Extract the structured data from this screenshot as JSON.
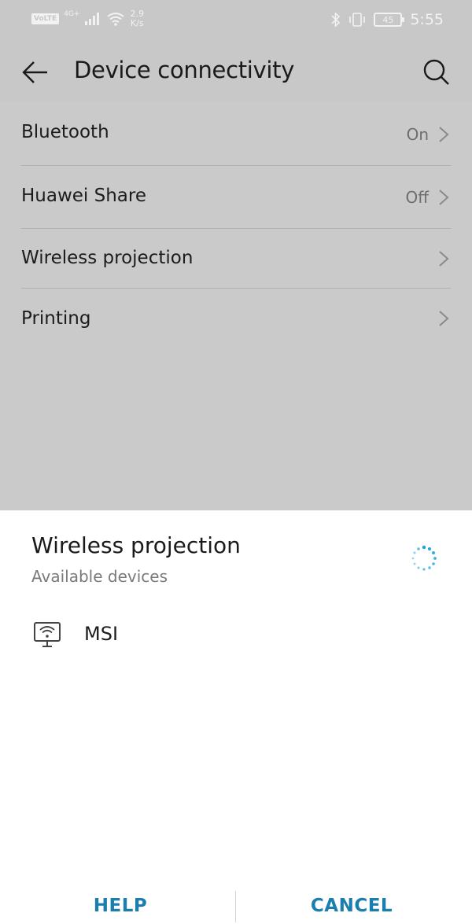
{
  "status_bar": {
    "volte": "VoLTE",
    "network_type": "4G+",
    "speed_value": "2.9",
    "speed_unit": "K/s",
    "battery_level": "45",
    "time": "5:55",
    "icons": [
      "volte-icon",
      "cellular-signal-icon",
      "wifi-icon",
      "bluetooth-icon",
      "vibrate-icon",
      "battery-icon"
    ]
  },
  "app_bar": {
    "title": "Device connectivity",
    "back_icon": "arrow-left-icon",
    "search_icon": "search-icon"
  },
  "settings": {
    "items": [
      {
        "label": "Bluetooth",
        "value": "On"
      },
      {
        "label": "Huawei Share",
        "value": "Off"
      },
      {
        "label": "Wireless projection",
        "value": ""
      },
      {
        "label": "Printing",
        "value": ""
      }
    ]
  },
  "dialog": {
    "title": "Wireless projection",
    "subtitle": "Available devices",
    "devices": [
      {
        "name": "MSI",
        "icon": "wireless-display-icon"
      }
    ],
    "help_label": "HELP",
    "cancel_label": "CANCEL"
  },
  "colors": {
    "accent": "#1a7fae",
    "spinner": "#1fa3d6",
    "scrim_background": "#c8c8c8",
    "sheet_background": "#ffffff"
  }
}
